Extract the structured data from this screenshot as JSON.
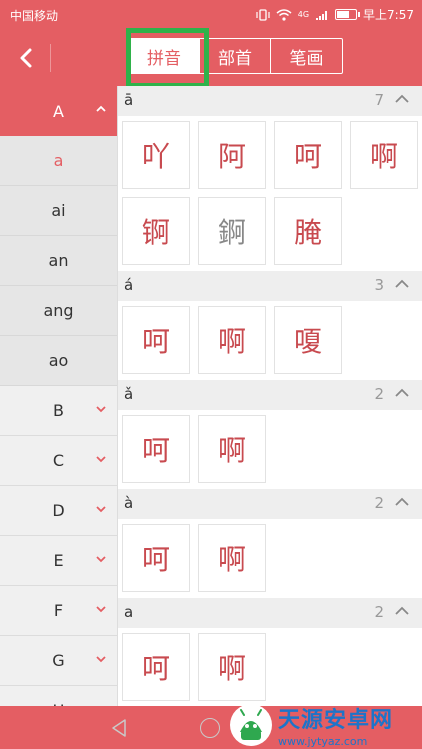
{
  "status_bar": {
    "carrier": "中国移动",
    "time": "早上7:57",
    "signal_label": "4G"
  },
  "header": {
    "tabs": [
      {
        "label": "拼音",
        "active": true
      },
      {
        "label": "部首",
        "active": false
      },
      {
        "label": "笔画",
        "active": false
      }
    ]
  },
  "sidebar": {
    "letters": [
      "A",
      "B",
      "C",
      "D",
      "E",
      "F",
      "G",
      "H"
    ],
    "open_letter": "A",
    "sub_items": [
      "a",
      "ai",
      "an",
      "ang",
      "ao"
    ],
    "selected_sub": "a"
  },
  "content": {
    "groups": [
      {
        "pinyin": "ā",
        "count": "7",
        "chars": [
          "吖",
          "阿",
          "呵",
          "啊",
          "锕",
          "錒",
          "腌"
        ],
        "gray_index": 5
      },
      {
        "pinyin": "á",
        "count": "3",
        "chars": [
          "呵",
          "啊",
          "嗄"
        ]
      },
      {
        "pinyin": "ǎ",
        "count": "2",
        "chars": [
          "呵",
          "啊"
        ]
      },
      {
        "pinyin": "à",
        "count": "2",
        "chars": [
          "呵",
          "啊"
        ]
      },
      {
        "pinyin": "a",
        "count": "2",
        "chars": [
          "呵",
          "啊"
        ]
      }
    ]
  },
  "watermark": {
    "title": "天源安卓网",
    "url": "www.jytyaz.com"
  },
  "colors": {
    "primary": "#e45e63",
    "highlight": "#2fb24a",
    "char": "#c84a4f",
    "watermark": "#1e74c9"
  },
  "icons": [
    "back-arrow-icon",
    "chevron-up-icon",
    "chevron-down-icon",
    "wifi-icon",
    "battery-icon",
    "nav-back-icon",
    "nav-home-icon"
  ]
}
